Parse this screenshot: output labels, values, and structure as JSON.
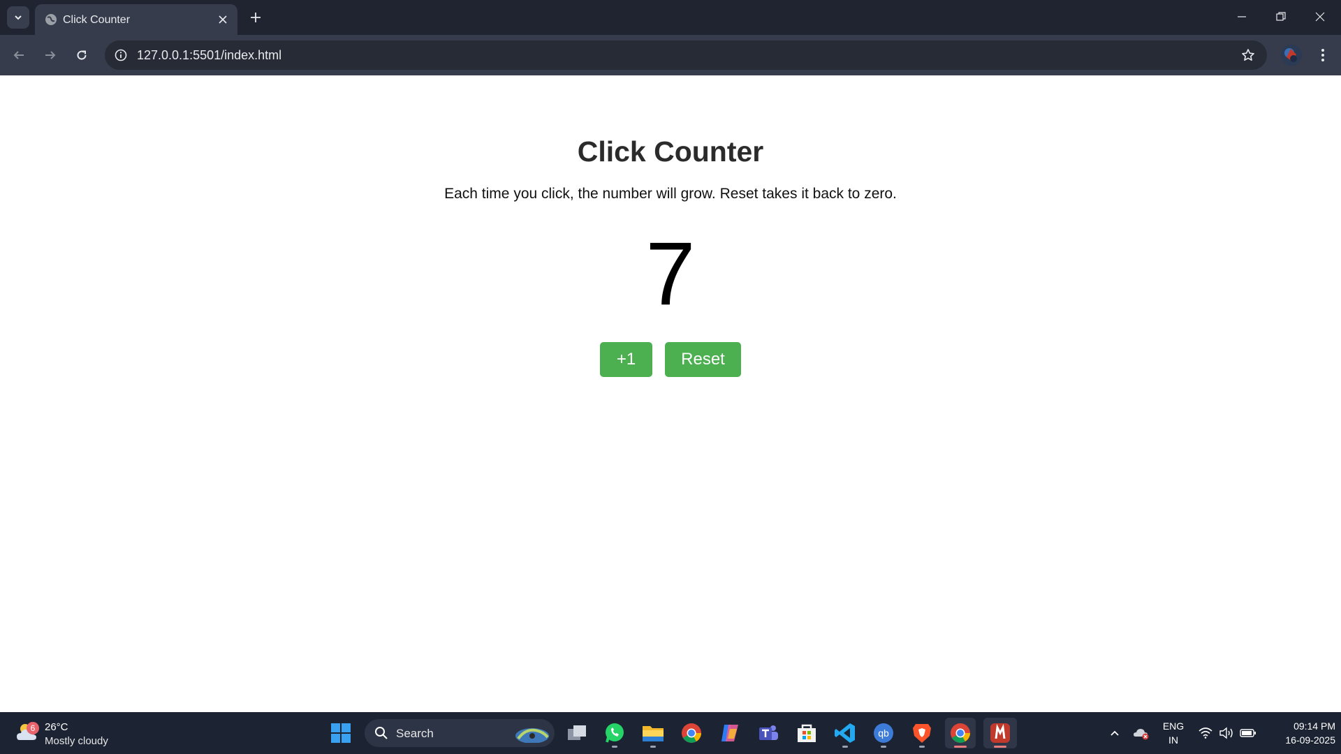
{
  "browser": {
    "tab_title": "Click Counter",
    "url": "127.0.0.1:5501/index.html"
  },
  "page": {
    "title": "Click Counter",
    "description": "Each time you click, the number will grow. Reset takes it back to zero.",
    "count": "7",
    "increment_label": "+1",
    "reset_label": "Reset",
    "button_color": "#4caf50"
  },
  "taskbar": {
    "weather_badge": "6",
    "weather_temp": "26°C",
    "weather_condition": "Mostly cloudy",
    "search_label": "Search",
    "apps": [
      "start-icon",
      "search",
      "task-view-icon",
      "whatsapp-icon",
      "file-explorer-icon",
      "chrome-icon",
      "copilot-icon",
      "teams-icon",
      "microsoft-store-icon",
      "vscode-icon",
      "qbittorrent-icon",
      "brave-icon",
      "chrome-icon",
      "app-icon"
    ],
    "lang_line1": "ENG",
    "lang_line2": "IN",
    "time": "09:14 PM",
    "date": "16-09-2025"
  }
}
